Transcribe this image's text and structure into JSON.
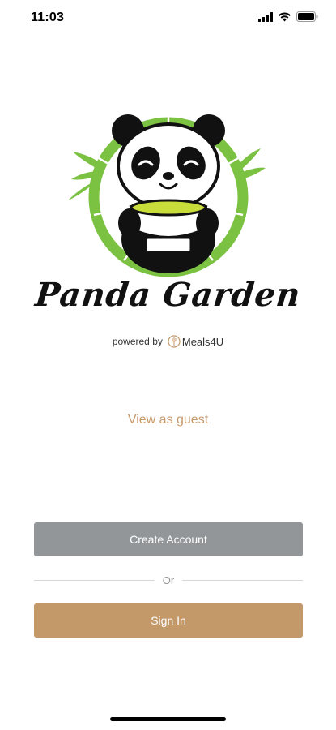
{
  "status_bar": {
    "time": "11:03",
    "icons": [
      "signal-icon",
      "wifi-icon",
      "battery-icon"
    ]
  },
  "brand": {
    "name": "Panda Garden",
    "powered_by_label": "powered by",
    "powered_by_brand": "Meals4U"
  },
  "actions": {
    "guest_label": "View as guest",
    "create_account_label": "Create Account",
    "divider_label": "Or",
    "sign_in_label": "Sign In"
  },
  "colors": {
    "accent": "#c4996a",
    "secondary_button": "#939699",
    "bamboo_green": "#7cc242"
  }
}
